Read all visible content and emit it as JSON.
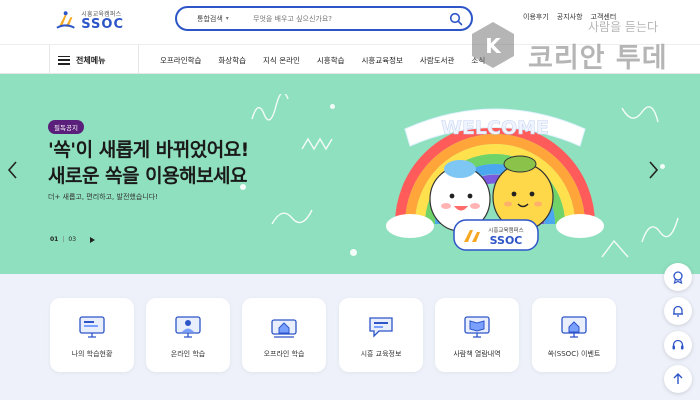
{
  "header": {
    "logo_small": "시흥교육캠퍼스",
    "logo_big": "SSOC",
    "search": {
      "category": "통합검색",
      "placeholder": "무엇을 배우고 싶으신가요?"
    },
    "util_links": [
      "이용후기",
      "공지사항",
      "고객센터"
    ]
  },
  "watermark": {
    "title": "코리안 투데이",
    "subtitle": "사람을 듣는다",
    "logo_letter": "K"
  },
  "nav": {
    "menu_label": "전체메뉴",
    "items": [
      "오프라인학습",
      "화상학습",
      "지식 온라인",
      "시흥학습",
      "시흥교육정보",
      "사람도서관",
      "소식"
    ]
  },
  "hero": {
    "badge": "필독공지",
    "title_line1": "'쏙'이 새롭게 바뀌었어요!",
    "title_line2": "새로운 쏙을 이용해보세요",
    "description": "더+ 새롭고, 편리하고, 발전했습니다!",
    "pager_current": "01",
    "pager_sep": "|",
    "pager_total": "03",
    "art_banner": "WELCOME",
    "art_sign_small": "시흥교육캠퍼스",
    "art_sign_big": "SSOC"
  },
  "quick_menu": [
    {
      "label": "나의 학습현황",
      "icon": "monitor-progress-icon"
    },
    {
      "label": "온라인 학습",
      "icon": "online-teacher-icon"
    },
    {
      "label": "오프라인 학습",
      "icon": "classroom-icon"
    },
    {
      "label": "시흥 교육정보",
      "icon": "chat-info-icon"
    },
    {
      "label": "사람책 열람내역",
      "icon": "book-monitor-icon"
    },
    {
      "label": "쏙(SSOC) 이벤트",
      "icon": "event-house-icon"
    }
  ],
  "colors": {
    "brand_blue": "#2d55c8",
    "hero_bg": "#8fe0bf",
    "badge_bg": "#5a1f7a",
    "quick_bg": "#eef1fa"
  }
}
